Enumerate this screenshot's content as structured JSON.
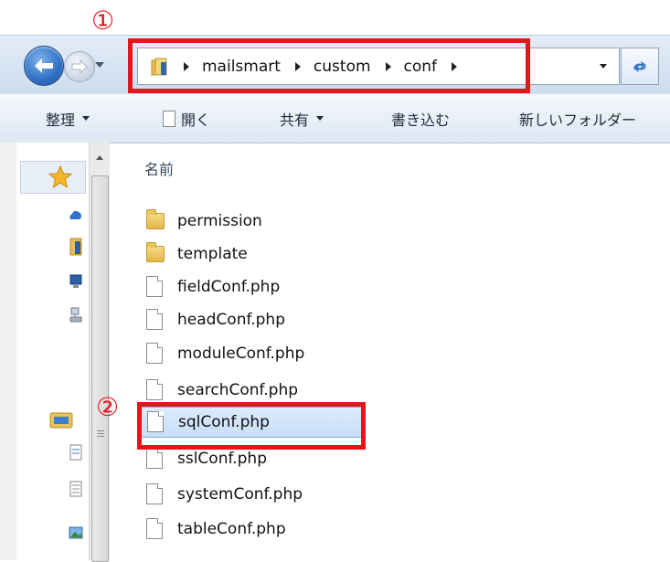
{
  "address_bar": {
    "breadcrumbs": [
      "mailsmart",
      "custom",
      "conf"
    ]
  },
  "callouts": {
    "one": "①",
    "two": "②"
  },
  "command_bar": {
    "organize": "整理",
    "open": "開く",
    "share": "共有",
    "burn": "書き込む",
    "new_folder": "新しいフォルダー"
  },
  "file_list": {
    "column_name": "名前",
    "items": [
      {
        "name": "permission",
        "type": "folder-icon"
      },
      {
        "name": "template",
        "type": "folder-icon"
      },
      {
        "name": "fieldConf.php",
        "type": "file-icon"
      },
      {
        "name": "headConf.php",
        "type": "file-icon"
      },
      {
        "name": "moduleConf.php",
        "type": "file-icon"
      },
      {
        "name": "searchConf.php",
        "type": "file-icon"
      },
      {
        "name": "sqlConf.php",
        "type": "file-icon",
        "selected": true
      },
      {
        "name": "sslConf.php",
        "type": "file-icon"
      },
      {
        "name": "systemConf.php",
        "type": "file-icon"
      },
      {
        "name": "tableConf.php",
        "type": "file-icon"
      }
    ]
  },
  "colors": {
    "callout_red": "#e8141c",
    "selection_bg": "#cde3fb",
    "selection_border": "#84acdd"
  }
}
